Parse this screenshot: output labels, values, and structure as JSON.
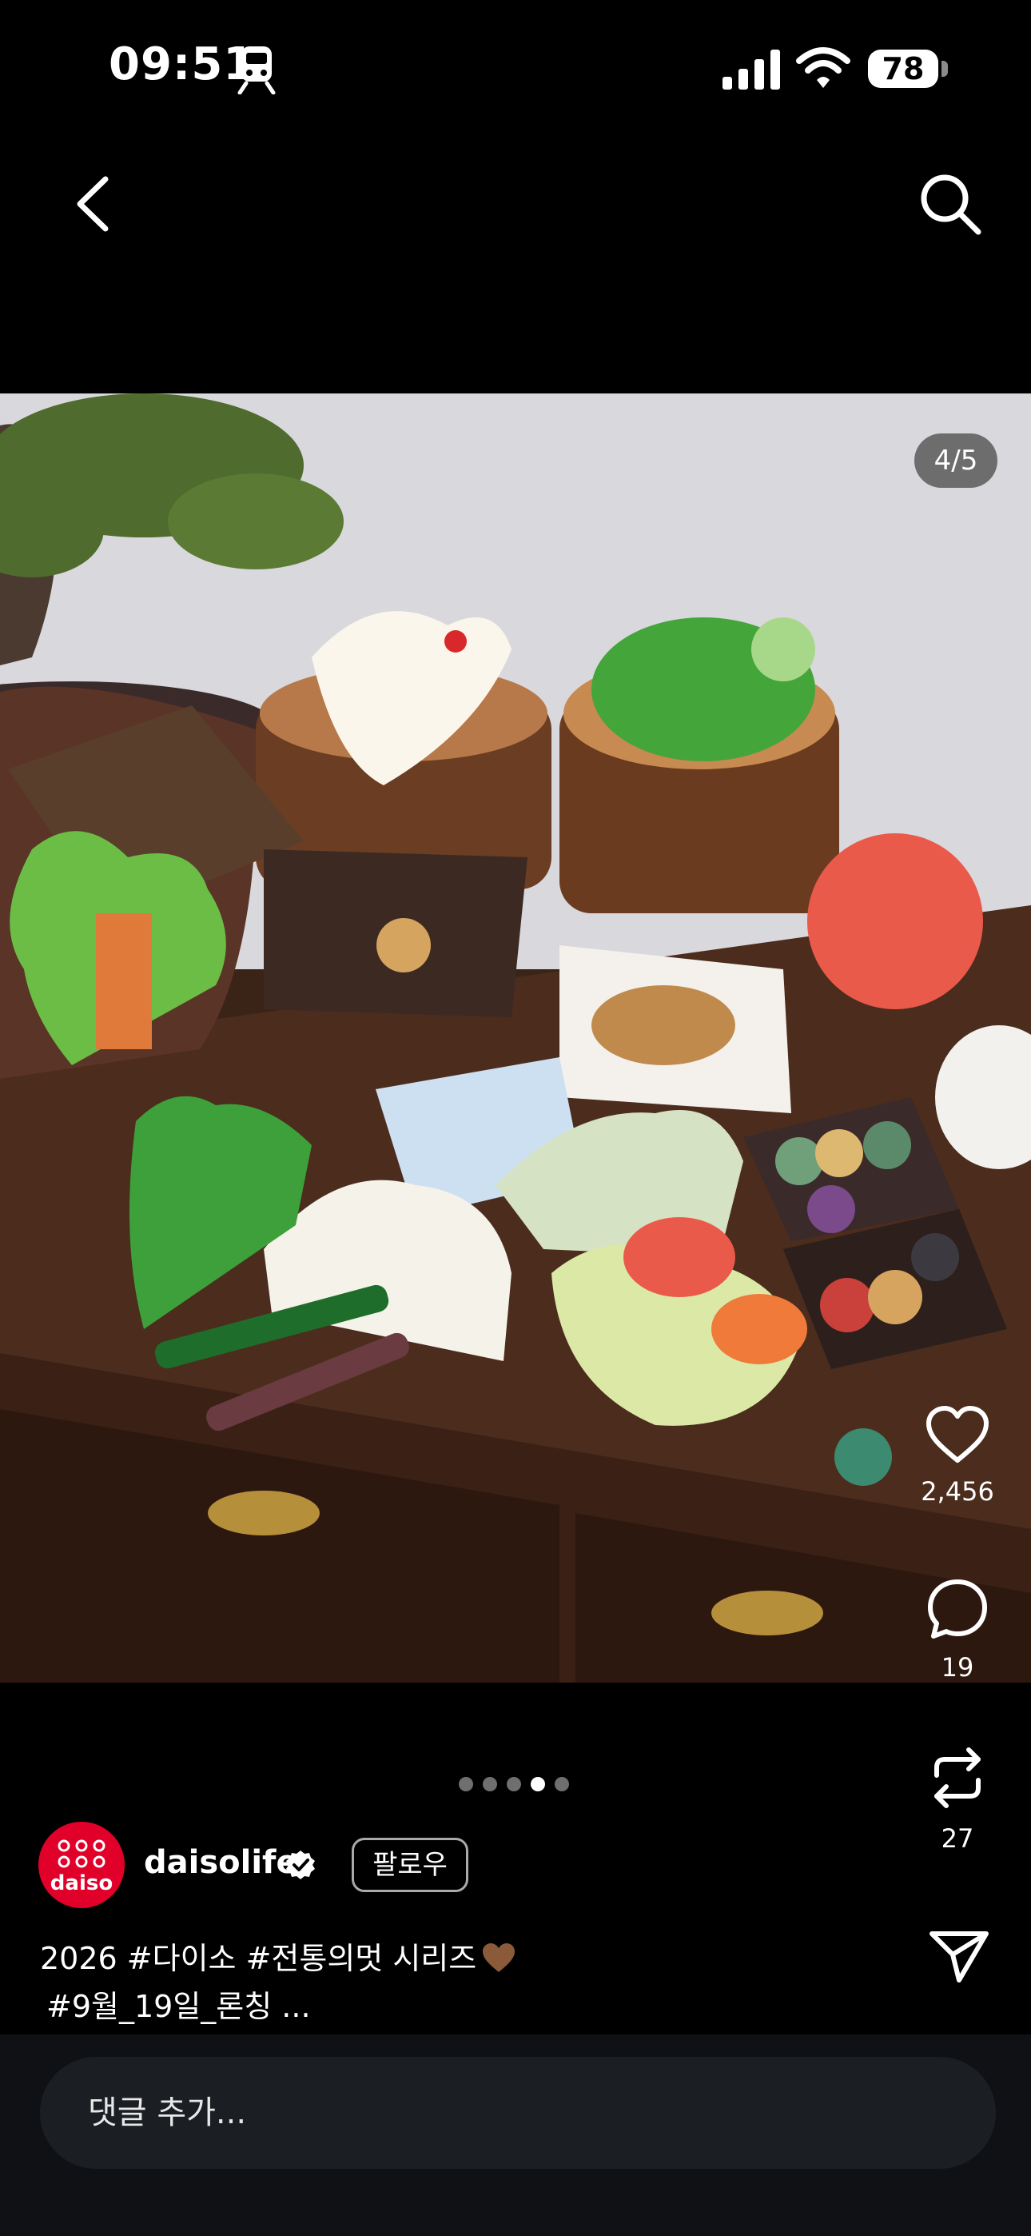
{
  "status_bar": {
    "time": "09:51",
    "battery": "78",
    "icons": [
      "train-icon",
      "signal-icon",
      "wifi-icon",
      "battery-icon"
    ]
  },
  "nav": {
    "back_icon": "chevron-left-icon",
    "search_icon": "search-icon"
  },
  "post": {
    "page_counter": "4/5",
    "current_page": 4,
    "total_pages": 5,
    "likes": "2,456",
    "comments": "19",
    "reposts": "27",
    "author": {
      "username": "daisolife",
      "avatar_text": "daiso",
      "verified": true
    },
    "follow_label": "팔로우",
    "caption_line1": "2026 #다이소 #전통의멋 시리즈",
    "caption_line2": "#9월_19일_론칭 ..."
  },
  "comment_box": {
    "placeholder": "댓글 추가..."
  },
  "colors": {
    "background": "#000000",
    "avatar": "#e0002a",
    "comment_bar": "#0f1114",
    "comment_input": "#1b1e23"
  }
}
